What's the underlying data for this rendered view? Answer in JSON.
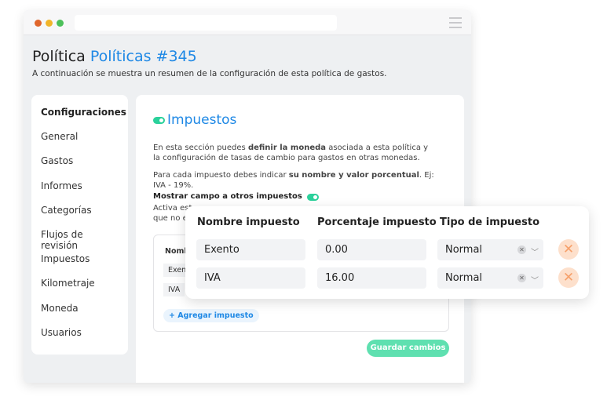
{
  "header": {
    "title": "Política",
    "title_link": "Políticas #345",
    "subtitle": "A continuación se muestra un resumen de la configuración de esta política de gastos."
  },
  "sidebar": {
    "heading": "Configuraciones",
    "items": [
      "General",
      "Gastos",
      "Informes",
      "Categorías",
      "Flujos de revisión",
      "Impuestos",
      "Kilometraje",
      "Moneda",
      "Usuarios"
    ]
  },
  "section": {
    "title": "Impuestos",
    "p1_a": "En esta sección puedes ",
    "p1_b": "definir la moneda",
    "p1_c": " asociada a esta política y la configuración de tasas de cambio para gastos en otras monedas.",
    "p2_a": "Para cada impuesto debes indicar ",
    "p2_b": "su nombre y valor porcentual",
    "p2_c": ". Ej: IVA - 19%.",
    "toggle_label": "Mostrar campo a otros impuestos",
    "desc_1": "Activa est",
    "desc_2": "que no e",
    "inner_header": "Nomb",
    "inner_rows": [
      "Exen",
      "IVA"
    ],
    "add_label": "+ Agregar impuesto",
    "save_label": "Guardar cambios"
  },
  "table": {
    "columns": [
      "Nombre impuesto",
      "Porcentaje impuesto",
      "Tipo de impuesto"
    ],
    "rows": [
      {
        "name": "Exento",
        "percent": "0.00",
        "type": "Normal"
      },
      {
        "name": "IVA",
        "percent": "16.00",
        "type": "Normal"
      }
    ]
  },
  "colors": {
    "accent": "#1e88e5",
    "toggle": "#2bd19b",
    "save": "#5fe0b0",
    "delete": "#f6a06a"
  }
}
